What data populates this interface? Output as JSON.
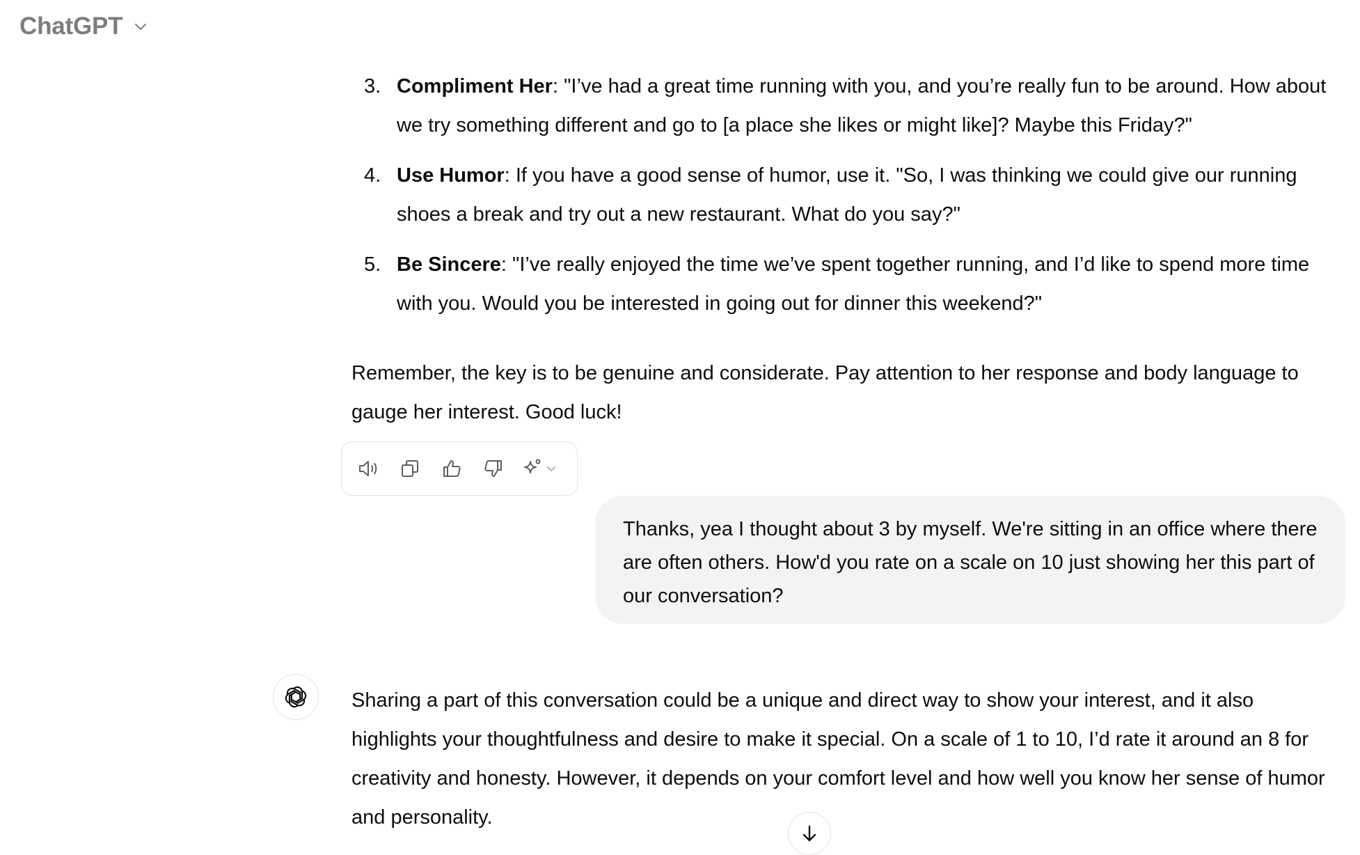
{
  "header": {
    "model_name": "ChatGPT",
    "chevron_icon": "chevron-down-icon"
  },
  "assistant_prev": {
    "tips": [
      {
        "number": "3.",
        "title": "Compliment Her",
        "text": ": \"I’ve had a great time running with you, and you’re really fun to be around. How about we try something different and go to [a place she likes or might like]? Maybe this Friday?\""
      },
      {
        "number": "4.",
        "title": "Use Humor",
        "text": ": If you have a good sense of humor, use it. \"So, I was thinking we could give our running shoes a break and try out a new restaurant. What do you say?\""
      },
      {
        "number": "5.",
        "title": "Be Sincere",
        "text": ": \"I’ve really enjoyed the time we’ve spent together running, and I’d like to spend more time with you. Would you be interested in going out for dinner this weekend?\""
      }
    ],
    "closing": "Remember, the key is to be genuine and considerate. Pay attention to her response and body language to gauge her interest. Good luck!"
  },
  "actions": {
    "icons": [
      "speaker-icon",
      "copy-icon",
      "thumbs-up-icon",
      "thumbs-down-icon",
      "sparkle-icon",
      "chevron-down-icon"
    ]
  },
  "user_message": {
    "text": "Thanks, yea I thought about 3 by myself. We're sitting in an office where there are often others. How'd you rate on a scale on 10 just showing her this part of our conversation?"
  },
  "assistant_reply": {
    "avatar_icon": "openai-logo-icon",
    "text": "Sharing a part of this conversation could be a unique and direct way to show your interest, and it also highlights your thoughtfulness and desire to make it special. On a scale of 1 to 10, I’d rate it around an 8 for creativity and honesty. However, it depends on your comfort level and how well you know her sense of humor and personality."
  },
  "scroll_button": {
    "icon": "arrow-down-icon"
  },
  "colors": {
    "bubble_bg": "#f3f3f3",
    "border": "#e3e3e3",
    "muted_text": "#7d7d7d",
    "text": "#0d0d0d"
  }
}
